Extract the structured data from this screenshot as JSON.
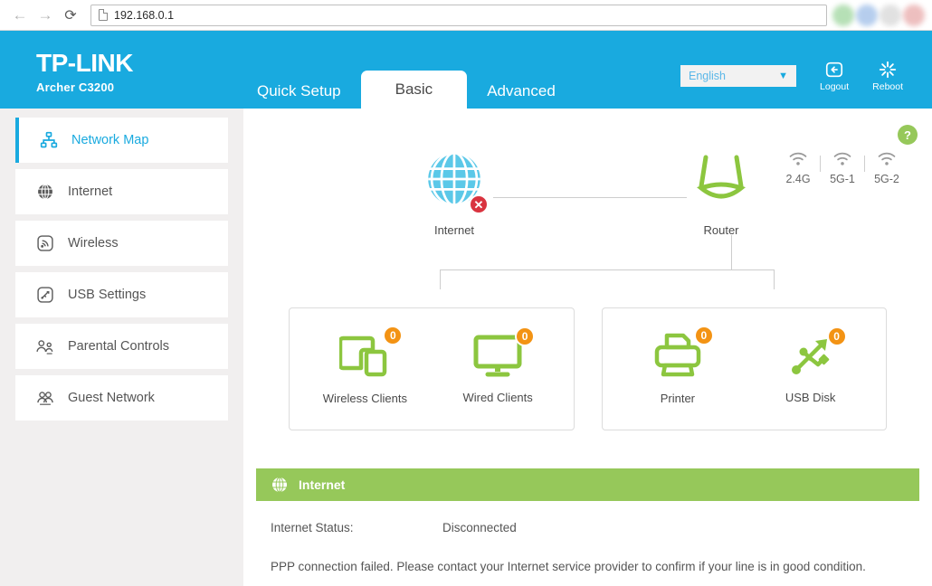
{
  "browser": {
    "back_icon": "back-arrow-icon",
    "forward_icon": "forward-arrow-icon",
    "reload_icon": "reload-icon",
    "page_icon": "page-icon",
    "url": "192.168.0.1"
  },
  "header": {
    "brand": "TP-LINK",
    "model": "Archer C3200",
    "tabs": [
      {
        "label": "Quick Setup",
        "active": false
      },
      {
        "label": "Basic",
        "active": true
      },
      {
        "label": "Advanced",
        "active": false
      }
    ],
    "language": {
      "value": "English",
      "chevron": "chevron-down-icon"
    },
    "logout": {
      "label": "Logout",
      "icon": "logout-icon"
    },
    "reboot": {
      "label": "Reboot",
      "icon": "reboot-icon"
    },
    "bg_color": "#19aadf"
  },
  "sidebar": {
    "items": [
      {
        "label": "Network Map",
        "icon": "network-map-icon",
        "active": true
      },
      {
        "label": "Internet",
        "icon": "globe-icon",
        "active": false
      },
      {
        "label": "Wireless",
        "icon": "wireless-signal-icon",
        "active": false
      },
      {
        "label": "USB Settings",
        "icon": "usb-icon",
        "active": false
      },
      {
        "label": "Parental Controls",
        "icon": "parental-controls-icon",
        "active": false
      },
      {
        "label": "Guest Network",
        "icon": "guest-network-icon",
        "active": false
      }
    ]
  },
  "content": {
    "help_label": "?",
    "map": {
      "internet": {
        "label": "Internet",
        "icon": "globe-icon",
        "status_badge": "✕",
        "status_color": "#d9333f"
      },
      "router": {
        "label": "Router",
        "icon": "router-icon"
      },
      "bands": [
        {
          "label": "2.4G",
          "icon": "wifi-icon"
        },
        {
          "label": "5G-1",
          "icon": "wifi-icon"
        },
        {
          "label": "5G-2",
          "icon": "wifi-icon"
        }
      ],
      "cards": [
        {
          "devices": [
            {
              "label": "Wireless Clients",
              "count": "0",
              "icon": "wireless-clients-icon"
            },
            {
              "label": "Wired Clients",
              "count": "0",
              "icon": "wired-clients-icon"
            }
          ]
        },
        {
          "devices": [
            {
              "label": "Printer",
              "count": "0",
              "icon": "printer-icon"
            },
            {
              "label": "USB Disk",
              "count": "0",
              "icon": "usb-disk-icon"
            }
          ]
        }
      ]
    },
    "internet_panel": {
      "title": "Internet",
      "icon": "globe-icon",
      "accent_color": "#96c85a",
      "status_key": "Internet Status:",
      "status_value": "Disconnected",
      "note": "PPP connection failed. Please contact your Internet service provider to confirm if your line is in good condition."
    }
  }
}
